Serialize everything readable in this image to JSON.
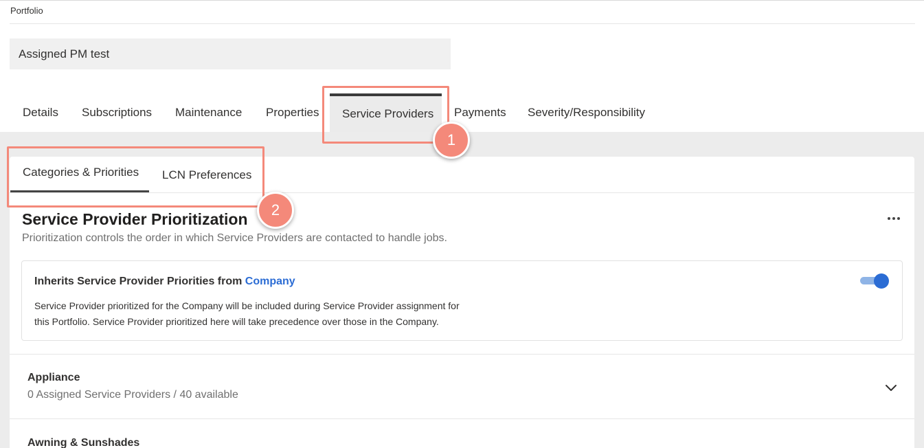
{
  "breadcrumb": "Portfolio",
  "portfolio_name": "Assigned PM test",
  "tabs": [
    {
      "label": "Details"
    },
    {
      "label": "Subscriptions"
    },
    {
      "label": "Maintenance"
    },
    {
      "label": "Properties"
    },
    {
      "label": "Service Providers",
      "active": true
    },
    {
      "label": "Payments"
    },
    {
      "label": "Severity/Responsibility"
    }
  ],
  "subtabs": [
    {
      "label": "Categories & Priorities",
      "active": true
    },
    {
      "label": "LCN Preferences"
    }
  ],
  "section": {
    "title": "Service Provider Prioritization",
    "description": "Prioritization controls the order in which Service Providers are contacted to handle jobs.",
    "more_icon": "ellipsis-icon"
  },
  "inherit": {
    "title_prefix": "Inherits Service Provider Priorities from ",
    "link": "Company",
    "line1": "Service Provider prioritized for the Company will be included during Service Provider assignment for",
    "line2": "this Portfolio. Service Provider prioritized here will take precedence over those in the Company.",
    "toggle_on": true
  },
  "categories": [
    {
      "name": "Appliance",
      "count": "0 Assigned Service Providers / 40 available",
      "icon": "chevron-down-icon"
    },
    {
      "name": "Awning & Sunshades"
    }
  ],
  "callouts": [
    {
      "number": "1"
    },
    {
      "number": "2"
    }
  ],
  "colors": {
    "accent": "#2b6cd4",
    "callout": "#f4897a",
    "active_tab_bg": "#ebebeb"
  }
}
